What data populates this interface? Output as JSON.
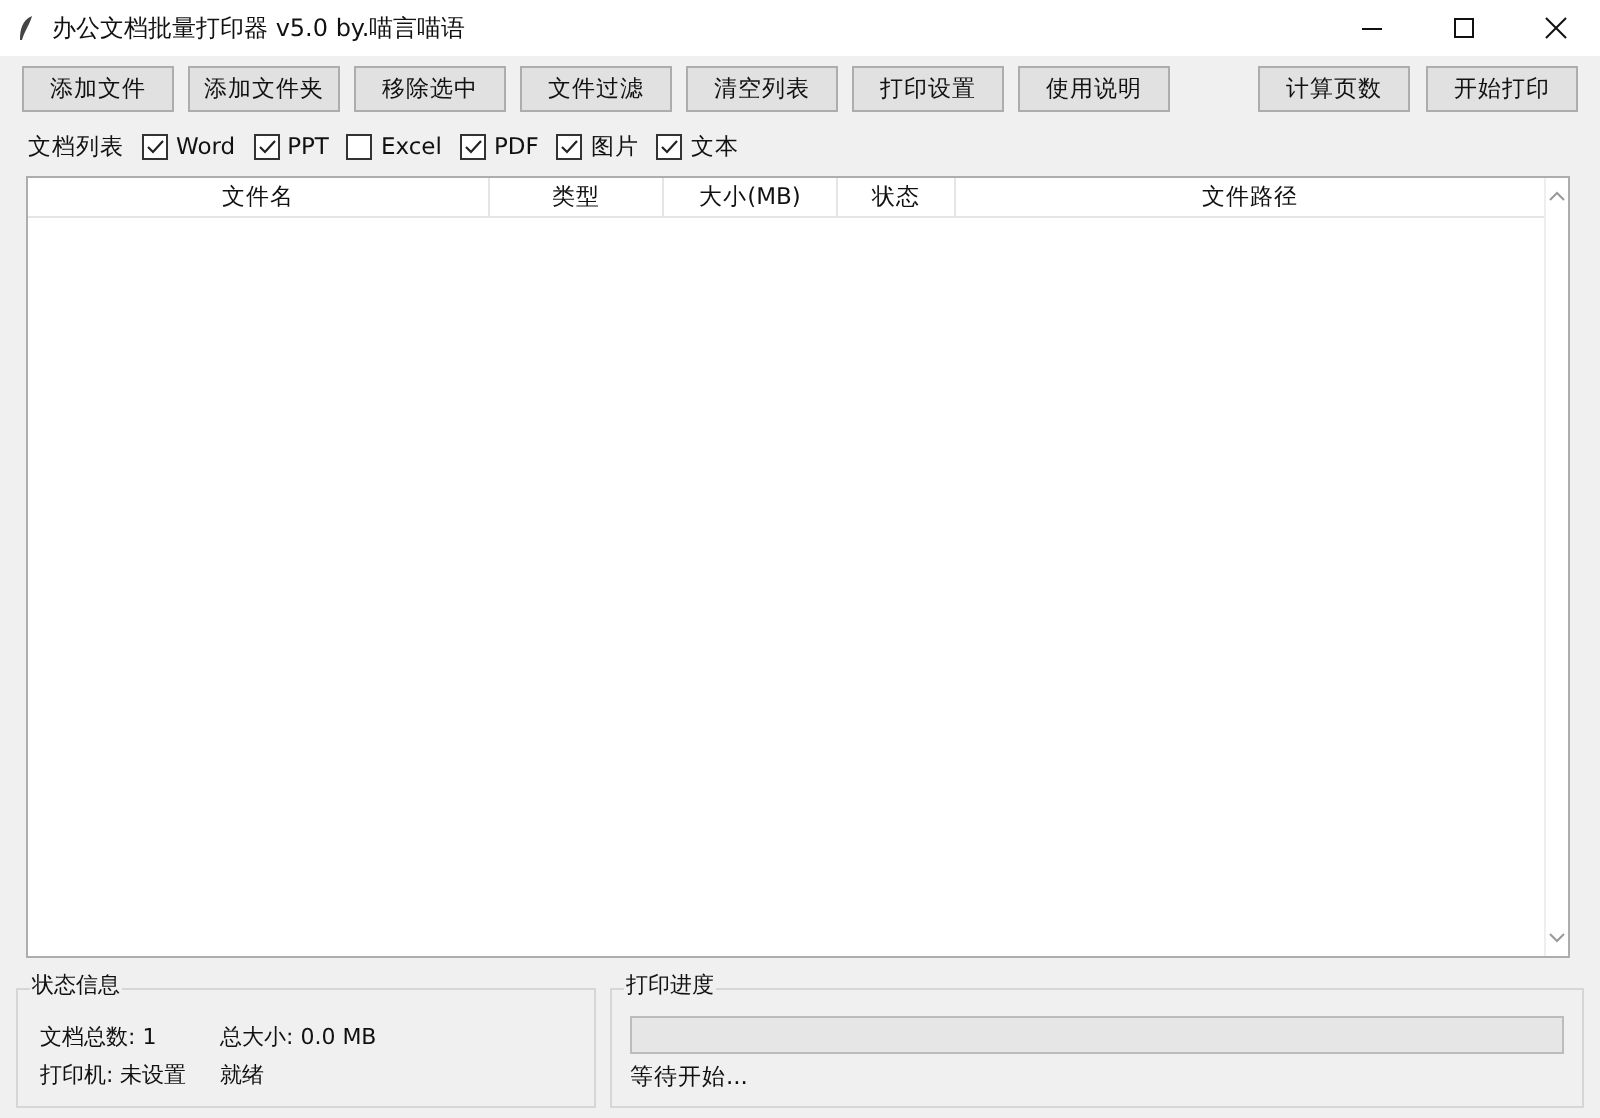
{
  "window": {
    "title": "办公文档批量打印器 v5.0 by.喵言喵语"
  },
  "toolbar": {
    "left": [
      "添加文件",
      "添加文件夹",
      "移除选中",
      "文件过滤",
      "清空列表",
      "打印设置",
      "使用说明"
    ],
    "right": [
      "计算页数",
      "开始打印"
    ]
  },
  "filter": {
    "label": "文档列表",
    "options": [
      {
        "label": "Word",
        "checked": true
      },
      {
        "label": "PPT",
        "checked": true
      },
      {
        "label": "Excel",
        "checked": false
      },
      {
        "label": "PDF",
        "checked": true
      },
      {
        "label": "图片",
        "checked": true
      },
      {
        "label": "文本",
        "checked": true
      }
    ]
  },
  "table": {
    "columns": [
      "文件名",
      "类型",
      "大小(MB)",
      "状态",
      "文件路径"
    ]
  },
  "status": {
    "title": "状态信息",
    "lines": [
      [
        "文档总数: 1",
        "总大小: 0.0 MB"
      ],
      [
        "打印机: 未设置",
        "就绪"
      ]
    ]
  },
  "progress": {
    "title": "打印进度",
    "level": 0,
    "text": "等待开始..."
  }
}
